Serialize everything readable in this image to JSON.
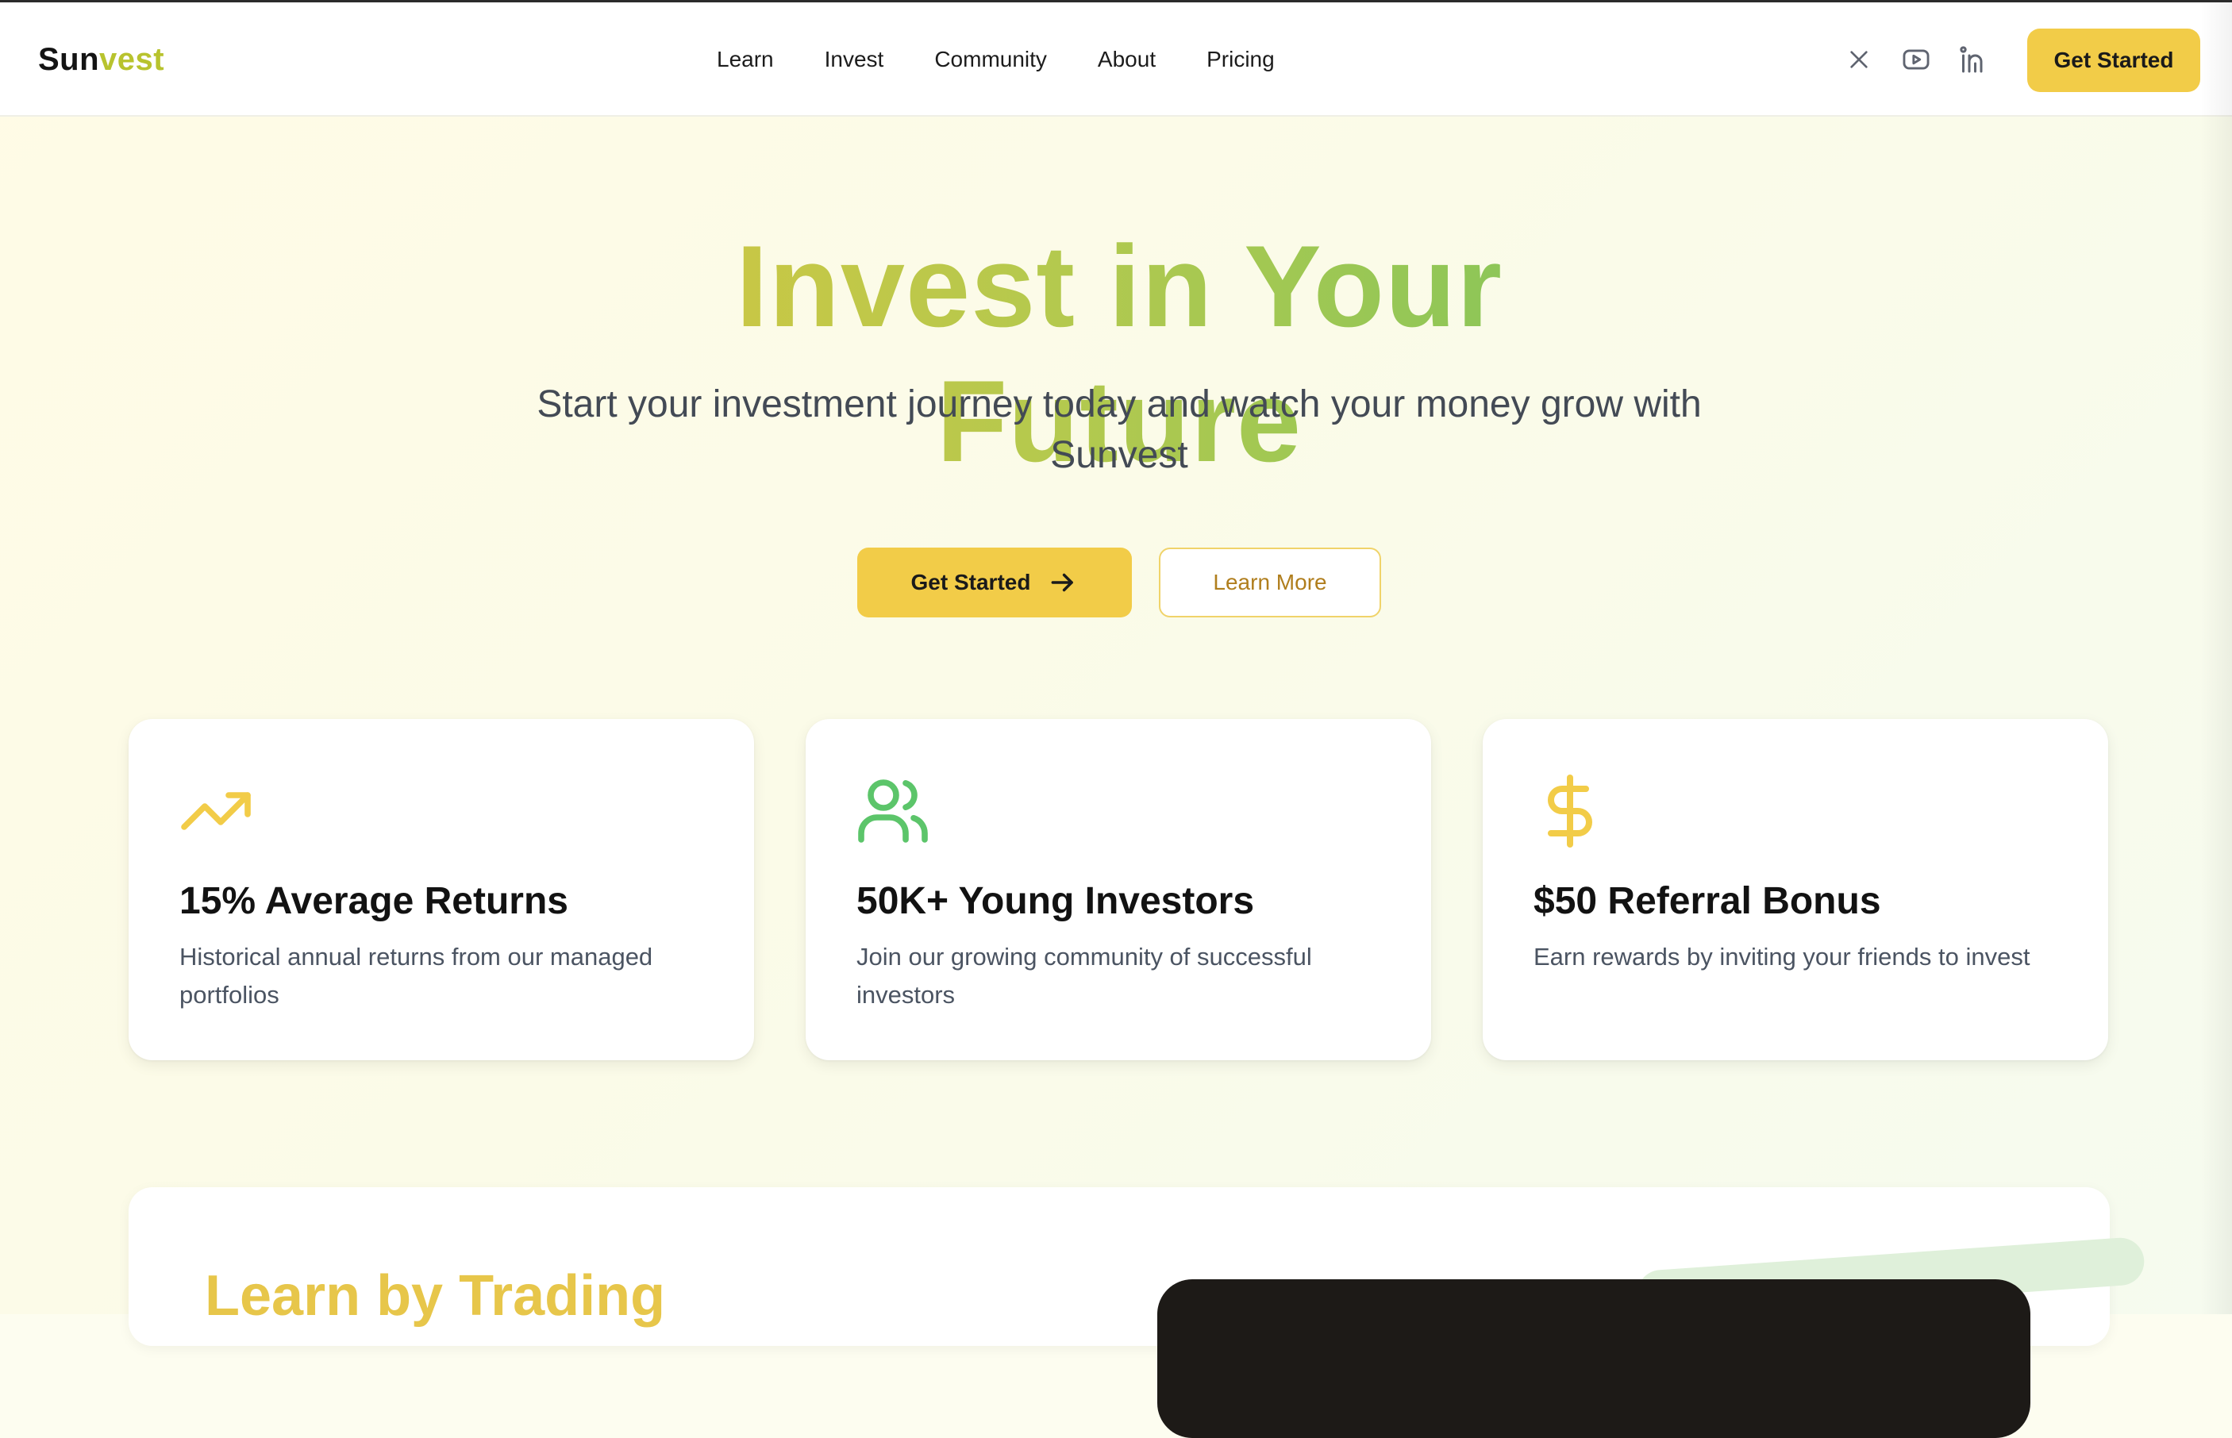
{
  "brand": {
    "part1": "Sun",
    "part2": "vest"
  },
  "nav": {
    "links": [
      "Learn",
      "Invest",
      "Community",
      "About",
      "Pricing"
    ],
    "social": [
      "x-icon",
      "youtube-icon",
      "linkedin-icon"
    ],
    "cta_label": "Get Started"
  },
  "hero": {
    "title": "Invest in Your Future",
    "subtitle": "Start your investment journey today and watch your money grow with Sunvest",
    "primary_label": "Get Started",
    "secondary_label": "Learn More"
  },
  "features": [
    {
      "icon": "trending-up-icon",
      "title": "15% Average Returns",
      "desc": "Historical annual returns from our managed portfolios",
      "color": "#f2cc48"
    },
    {
      "icon": "users-icon",
      "title": "50K+ Young Investors",
      "desc": "Join our growing community of successful investors",
      "color": "#5cc56a"
    },
    {
      "icon": "dollar-icon",
      "title": "$50 Referral Bonus",
      "desc": "Earn rewards by inviting your friends to invest",
      "color": "#f2cc48"
    }
  ],
  "learn": {
    "title": "Learn by Trading"
  },
  "colors": {
    "accent": "#f2cc48",
    "green": "#7cc55c",
    "text_muted": "#4b5462"
  }
}
